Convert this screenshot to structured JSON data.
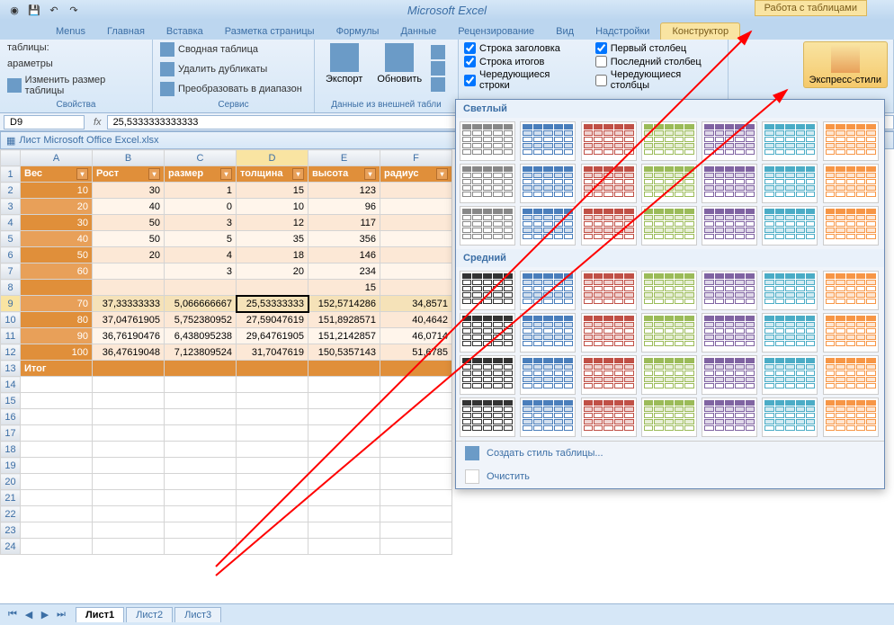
{
  "app_title": "Microsoft Excel",
  "context_tab": "Работа с таблицами",
  "ribbon_tabs": [
    "Menus",
    "Главная",
    "Вставка",
    "Разметка страницы",
    "Формулы",
    "Данные",
    "Рецензирование",
    "Вид",
    "Надстройки",
    "Конструктор"
  ],
  "active_tab": "Конструктор",
  "group_props": {
    "label": "Свойства",
    "table_label": "таблицы:",
    "params": "араметры",
    "resize": "Изменить размер таблицы"
  },
  "group_service": {
    "label": "Сервис",
    "pivot": "Сводная таблица",
    "dedup": "Удалить дубликаты",
    "convert": "Преобразовать в диапазон"
  },
  "group_ext": {
    "label": "Данные из внешней табли",
    "export": "Экспорт",
    "refresh": "Обновить"
  },
  "group_styleopts": {
    "header_row": "Строка заголовка",
    "total_row": "Строка итогов",
    "banded_rows": "Чередующиеся строки",
    "first_col": "Первый столбец",
    "last_col": "Последний столбец",
    "banded_cols": "Чередующиеся столбцы"
  },
  "express": "Экспресс-стили",
  "name_box": "D9",
  "formula": "25,5333333333333",
  "workbook": "Лист Microsoft Office Excel.xlsx",
  "columns": [
    "A",
    "B",
    "C",
    "D",
    "E",
    "F"
  ],
  "headers": [
    "Вес",
    "Рост",
    "размер",
    "толщина",
    "высота",
    "радиус"
  ],
  "rows": [
    [
      "10",
      "30",
      "1",
      "15",
      "123",
      ""
    ],
    [
      "20",
      "40",
      "0",
      "10",
      "96",
      ""
    ],
    [
      "30",
      "50",
      "3",
      "12",
      "117",
      ""
    ],
    [
      "40",
      "50",
      "5",
      "35",
      "356",
      ""
    ],
    [
      "50",
      "20",
      "4",
      "18",
      "146",
      ""
    ],
    [
      "60",
      "",
      "3",
      "20",
      "234",
      ""
    ],
    [
      "",
      "",
      "",
      "",
      "15",
      ""
    ],
    [
      "70",
      "37,33333333",
      "5,066666667",
      "25,53333333",
      "152,5714286",
      "34,8571"
    ],
    [
      "80",
      "37,04761905",
      "5,752380952",
      "27,59047619",
      "151,8928571",
      "40,4642"
    ],
    [
      "90",
      "36,76190476",
      "6,438095238",
      "29,64761905",
      "151,2142857",
      "46,0714"
    ],
    [
      "100",
      "36,47619048",
      "7,123809524",
      "31,7047619",
      "150,5357143",
      "51,6785"
    ]
  ],
  "total_label": "Итог",
  "gallery": {
    "light": "Светлый",
    "medium": "Средний",
    "new_style": "Создать стиль таблицы...",
    "clear": "Очистить"
  },
  "sheet_tabs": [
    "Лист1",
    "Лист2",
    "Лист3"
  ],
  "light_palette": [
    "#888",
    "#4a7ebb",
    "#c05046",
    "#9bbb59",
    "#8064a2",
    "#4bacc6",
    "#f79646"
  ],
  "medium_palette": [
    "#333",
    "#4a7ebb",
    "#c05046",
    "#9bbb59",
    "#8064a2",
    "#4bacc6",
    "#f79646"
  ]
}
